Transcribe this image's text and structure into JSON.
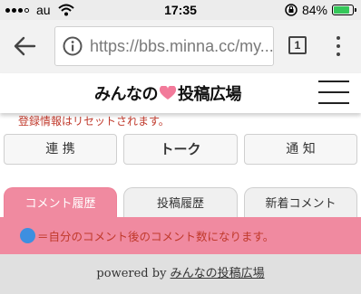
{
  "status_bar": {
    "carrier": "au",
    "time": "17:35",
    "battery": "84%",
    "battery_level": 0.84
  },
  "browser": {
    "url": "https://bbs.minna.cc/my...",
    "tab_count": "1"
  },
  "header": {
    "logo_left": "みんなの",
    "logo_right": "投稿広場"
  },
  "notice": "登録情報はリセットされます。",
  "buttons": {
    "link": "連 携",
    "talk": "トーク",
    "notify": "通 知"
  },
  "tabs": [
    {
      "label": "コメント履歴",
      "active": true
    },
    {
      "label": "投稿履歴",
      "active": false
    },
    {
      "label": "新着コメント",
      "active": false
    }
  ],
  "band_text": "＝自分のコメント後のコメント数になります。",
  "footer": {
    "prefix": "powered by ",
    "site_name": "みんなの投稿広場"
  },
  "colors": {
    "accent_pink": "#f08aa0",
    "notice_red": "#c0392b",
    "dot_blue": "#3d8fe0",
    "battery_green": "#34c759"
  }
}
